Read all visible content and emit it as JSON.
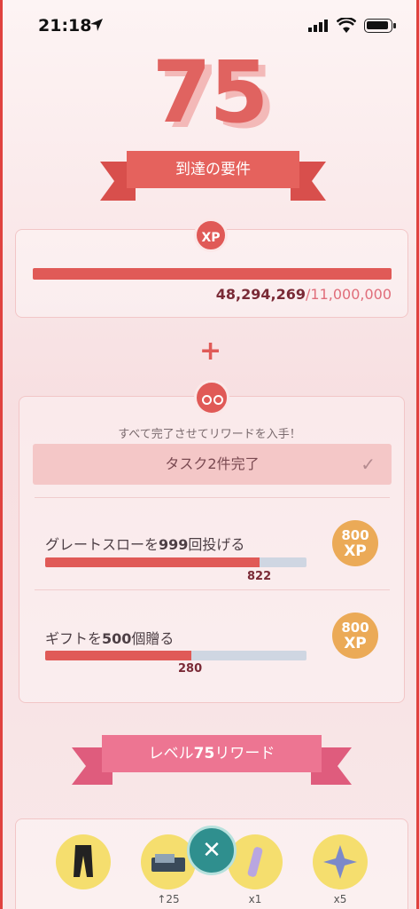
{
  "status_bar": {
    "time": "21:18"
  },
  "level": {
    "number": "75"
  },
  "requirements": {
    "title": "到達の要件"
  },
  "xp": {
    "badge": "XP",
    "current": "48,294,269",
    "total": "/11,000,000",
    "progress": 1.0
  },
  "plus_sign": "+",
  "tasks": {
    "subtitle": "すべて完了させてリワードを入手！",
    "completed_label": "タスク2件完了",
    "check_icon": "check-icon",
    "items": [
      {
        "label_prefix": "グレートスローを",
        "label_num": "999",
        "label_suffix": "回投げる",
        "value": "822",
        "progress": 0.82,
        "reward_amount": "800",
        "reward_unit": "XP"
      },
      {
        "label_prefix": "ギフトを",
        "label_num": "500",
        "label_suffix": "個贈る",
        "value": "280",
        "progress": 0.56,
        "reward_amount": "800",
        "reward_unit": "XP"
      }
    ]
  },
  "level_rewards": {
    "title_prefix": "レベル",
    "title_num": "75",
    "title_suffix": "リワード",
    "items": [
      {
        "icon": "pants-icon",
        "label": ""
      },
      {
        "icon": "device-icon",
        "label": "↑25"
      },
      {
        "icon": "potion-icon",
        "label": "x1"
      },
      {
        "icon": "star-piece-icon",
        "label": "x5"
      }
    ]
  },
  "colors": {
    "accent": "#e05a57",
    "reward": "#ebaa57",
    "ribbon_pink": "#ed7592",
    "close": "#2f8f8e"
  }
}
